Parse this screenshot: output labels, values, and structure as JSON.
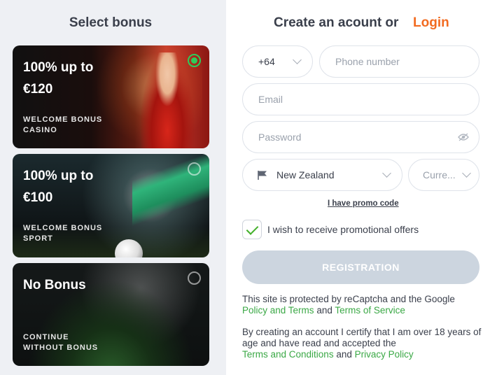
{
  "left": {
    "title": "Select bonus",
    "cards": [
      {
        "amount_line1": "100% up to",
        "amount_line2": "€120",
        "sub_line1": "WELCOME BONUS",
        "sub_line2": "CASINO",
        "selected": true
      },
      {
        "amount_line1": "100% up to",
        "amount_line2": "€100",
        "sub_line1": "WELCOME BONUS",
        "sub_line2": "SPORT",
        "selected": false
      },
      {
        "amount_line1": "No Bonus",
        "sub_line1": "CONTINUE",
        "sub_line2": "WITHOUT BONUS",
        "selected": false
      }
    ]
  },
  "form": {
    "heading": "Create an acount or",
    "login_link": "Login",
    "phone_code": "+64",
    "phone_placeholder": "Phone number",
    "email_placeholder": "Email",
    "password_placeholder": "Password",
    "country_value": "New Zealand",
    "currency_placeholder": "Curre...",
    "promo_link": "I have promo code",
    "offers_label": "I wish to receive promotional offers",
    "offers_checked": true,
    "register_label": "REGISTRATION",
    "recaptcha_text": "This site is protected by reCaptcha and the Google",
    "policy_link": "Policy and Terms",
    "and_text": "and",
    "tos_link": "Terms of Service",
    "certify_text": "By creating an account I certify that I am over 18 years of age and have read and accepted the",
    "terms_link": "Terms and Conditions",
    "privacy_link": "Privacy Policy"
  },
  "colors": {
    "accent_login": "#f26b21",
    "link_green": "#3aa845",
    "selected_radio": "#2ecc5a",
    "register_disabled": "#ccd5df"
  }
}
